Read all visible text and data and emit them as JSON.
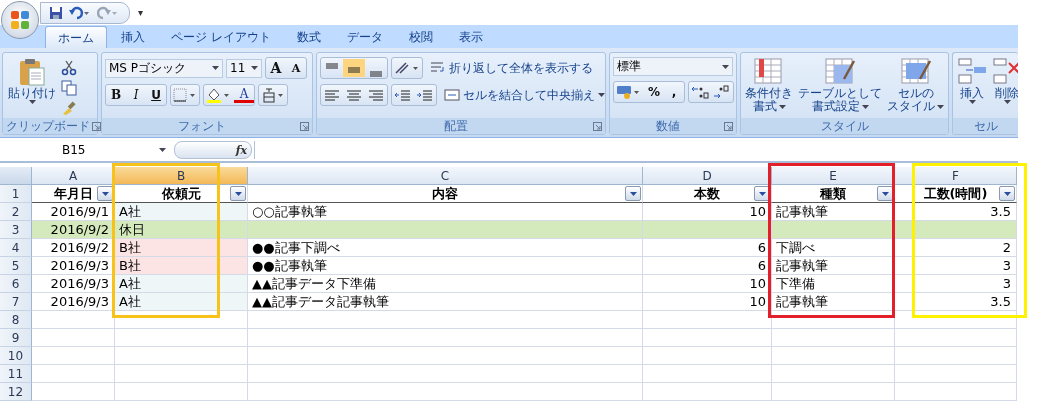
{
  "quick_access": {
    "customize": "▾"
  },
  "tabs": [
    {
      "label": "ホーム",
      "selected": true
    },
    {
      "label": "挿入",
      "selected": false
    },
    {
      "label": "ページ レイアウト",
      "selected": false
    },
    {
      "label": "数式",
      "selected": false
    },
    {
      "label": "データ",
      "selected": false
    },
    {
      "label": "校閲",
      "selected": false
    },
    {
      "label": "表示",
      "selected": false
    }
  ],
  "ribbon": {
    "groups": [
      {
        "kind": "clipboard",
        "label": "クリップボード",
        "launcher": true,
        "paste": "貼り付け"
      },
      {
        "kind": "font",
        "label": "フォント",
        "launcher": true,
        "font_name": "MS Pゴシック",
        "font_size": "11",
        "grow": "A",
        "shrink": "A",
        "bold": "B",
        "italic": "I",
        "underline": "U",
        "font_color": "A"
      },
      {
        "kind": "alignment",
        "label": "配置",
        "launcher": true,
        "valign": [
          {
            "selected": false
          },
          {
            "selected": true
          },
          {
            "selected": false
          }
        ],
        "wrap": "折り返して全体を表示する",
        "merge": "セルを結合して中央揃え"
      },
      {
        "kind": "number",
        "label": "数値",
        "launcher": true,
        "format": "標準",
        "percent": "%",
        "comma": ","
      },
      {
        "kind": "styles",
        "label": "スタイル",
        "launcher": false,
        "buttons": [
          {
            "lines": [
              "条件付き",
              "書式"
            ]
          },
          {
            "lines": [
              "テーブルとして",
              "書式設定"
            ]
          },
          {
            "lines": [
              "セルの",
              "スタイル"
            ]
          }
        ]
      },
      {
        "kind": "cells",
        "label": "セル",
        "launcher": false,
        "buttons": [
          {
            "label": "挿入"
          },
          {
            "label": "削除"
          }
        ]
      }
    ]
  },
  "formula_bar": {
    "name_box": "B15",
    "function_label": "fx"
  },
  "columns": [
    {
      "letter": "A",
      "header": "年月日",
      "kind": "number",
      "selected": false
    },
    {
      "letter": "B",
      "header": "依頼元",
      "kind": "text",
      "selected": true,
      "frame": {
        "color": "#f7c21a"
      }
    },
    {
      "letter": "C",
      "header": "内容",
      "kind": "text",
      "selected": false
    },
    {
      "letter": "D",
      "header": "本数",
      "kind": "number",
      "selected": false
    },
    {
      "letter": "E",
      "header": "種類",
      "kind": "text",
      "selected": false,
      "frame": {
        "color": "#e3202a"
      }
    },
    {
      "letter": "F",
      "header": "工数(時間)",
      "kind": "number",
      "selected": false,
      "frame": {
        "color": "#fff200"
      }
    }
  ],
  "header_row": "1",
  "rows": [
    {
      "number": "2",
      "cells": [
        {
          "text": "2016/9/1"
        },
        {
          "text": "A社",
          "color": "#eef6f8"
        },
        {
          "text": "○○記事執筆"
        },
        {
          "text": "10"
        },
        {
          "text": "記事執筆"
        },
        {
          "text": "3.5"
        }
      ]
    },
    {
      "number": "3",
      "color": "#d4eabc",
      "cells": [
        {
          "text": "2016/9/2"
        },
        {
          "text": "休日"
        },
        {},
        {},
        {},
        {}
      ]
    },
    {
      "number": "4",
      "cells": [
        {
          "text": "2016/9/2"
        },
        {
          "text": "B社",
          "color": "#fde4e4"
        },
        {
          "text": "●●記事下調べ"
        },
        {
          "text": "6"
        },
        {
          "text": "下調べ"
        },
        {
          "text": "2"
        }
      ]
    },
    {
      "number": "5",
      "cells": [
        {
          "text": "2016/9/3"
        },
        {
          "text": "B社",
          "color": "#fde4e4"
        },
        {
          "text": "●●記事執筆"
        },
        {
          "text": "6"
        },
        {
          "text": "記事執筆"
        },
        {
          "text": "3"
        }
      ]
    },
    {
      "number": "6",
      "cells": [
        {
          "text": "2016/9/3"
        },
        {
          "text": "A社",
          "color": "#eef6f8"
        },
        {
          "text": "▲▲記事データ下準備"
        },
        {
          "text": "10"
        },
        {
          "text": "下準備"
        },
        {
          "text": "3"
        }
      ]
    },
    {
      "number": "7",
      "cells": [
        {
          "text": "2016/9/3"
        },
        {
          "text": "A社",
          "color": "#eef6f8"
        },
        {
          "text": "▲▲記事データ記事執筆"
        },
        {
          "text": "10"
        },
        {
          "text": "記事執筆"
        },
        {
          "text": "3.5"
        }
      ]
    },
    {
      "number": "8"
    },
    {
      "number": "9"
    },
    {
      "number": "10"
    },
    {
      "number": "11"
    },
    {
      "number": "12"
    }
  ]
}
